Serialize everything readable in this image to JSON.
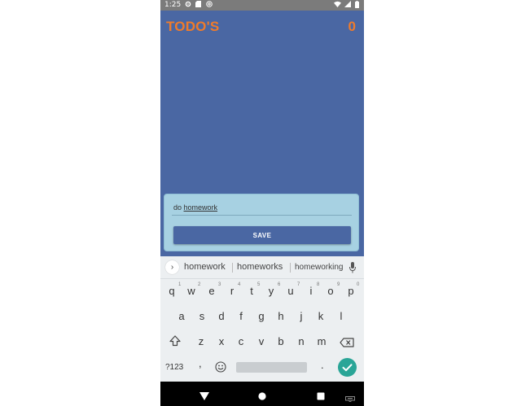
{
  "status_bar": {
    "time": "1:25",
    "icons_left": [
      "gear-icon",
      "sd-card-icon",
      "at-icon"
    ],
    "icons_right": [
      "wifi-icon",
      "signal-icon",
      "battery-icon"
    ]
  },
  "header": {
    "title": "TODO'S",
    "count": "0"
  },
  "todo_form": {
    "input_prefix": "do ",
    "input_word": "homework",
    "save_label": "SAVE"
  },
  "keyboard": {
    "suggestions": [
      "homework",
      "homeworks",
      "homeworking"
    ],
    "row1": [
      "q",
      "w",
      "e",
      "r",
      "t",
      "y",
      "u",
      "i",
      "o",
      "p"
    ],
    "row1_hints": [
      "1",
      "2",
      "3",
      "4",
      "5",
      "6",
      "7",
      "8",
      "9",
      "0"
    ],
    "row2": [
      "a",
      "s",
      "d",
      "f",
      "g",
      "h",
      "j",
      "k",
      "l"
    ],
    "row3": [
      "z",
      "x",
      "c",
      "v",
      "b",
      "n",
      "m"
    ],
    "symbols_label": "?123",
    "comma_label": ",",
    "period_label": "."
  },
  "colors": {
    "app_background": "#4a67a3",
    "accent": "#f07b2a",
    "card_background": "#a7d1e2",
    "enter_key": "#2aa597"
  }
}
